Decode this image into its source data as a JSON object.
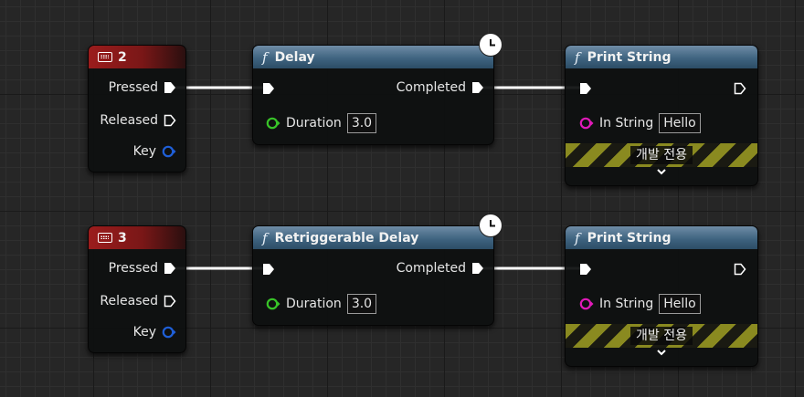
{
  "rows": [
    {
      "input_node": {
        "key": "2",
        "pins": {
          "pressed": "Pressed",
          "released": "Released",
          "key": "Key"
        }
      },
      "delay_node": {
        "title": "Delay",
        "completed": "Completed",
        "duration_label": "Duration",
        "duration_value": "3.0"
      },
      "print_node": {
        "title": "Print String",
        "in_string_label": "In String",
        "in_string_value": "Hello",
        "dev_only": "개발 전용"
      }
    },
    {
      "input_node": {
        "key": "3",
        "pins": {
          "pressed": "Pressed",
          "released": "Released",
          "key": "Key"
        }
      },
      "delay_node": {
        "title": "Retriggerable Delay",
        "completed": "Completed",
        "duration_label": "Duration",
        "duration_value": "3.0"
      },
      "print_node": {
        "title": "Print String",
        "in_string_label": "In String",
        "in_string_value": "Hello",
        "dev_only": "개발 전용"
      }
    }
  ],
  "icons": {
    "function": "f",
    "keyboard": "keyboard-icon",
    "clock": "clock-icon",
    "expand": "⌄"
  },
  "colors": {
    "exec_pin": "#ffffff",
    "key_pin": "#1f5fd8",
    "float_pin": "#38c428",
    "string_pin": "#e01ab8",
    "input_header": "#9b1c1c",
    "function_header": "#3f6480",
    "dev_stripe": "#8a8a20"
  }
}
